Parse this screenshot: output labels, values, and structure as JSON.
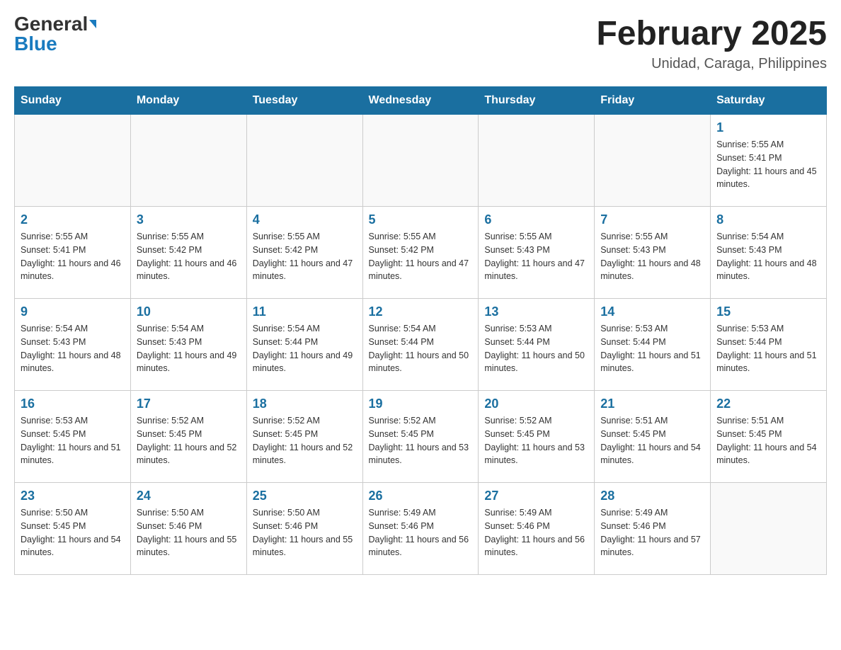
{
  "logo": {
    "general": "General",
    "blue": "Blue"
  },
  "title": {
    "month": "February 2025",
    "location": "Unidad, Caraga, Philippines"
  },
  "weekdays": [
    "Sunday",
    "Monday",
    "Tuesday",
    "Wednesday",
    "Thursday",
    "Friday",
    "Saturday"
  ],
  "weeks": [
    [
      {
        "day": "",
        "sunrise": "",
        "sunset": "",
        "daylight": ""
      },
      {
        "day": "",
        "sunrise": "",
        "sunset": "",
        "daylight": ""
      },
      {
        "day": "",
        "sunrise": "",
        "sunset": "",
        "daylight": ""
      },
      {
        "day": "",
        "sunrise": "",
        "sunset": "",
        "daylight": ""
      },
      {
        "day": "",
        "sunrise": "",
        "sunset": "",
        "daylight": ""
      },
      {
        "day": "",
        "sunrise": "",
        "sunset": "",
        "daylight": ""
      },
      {
        "day": "1",
        "sunrise": "Sunrise: 5:55 AM",
        "sunset": "Sunset: 5:41 PM",
        "daylight": "Daylight: 11 hours and 45 minutes."
      }
    ],
    [
      {
        "day": "2",
        "sunrise": "Sunrise: 5:55 AM",
        "sunset": "Sunset: 5:41 PM",
        "daylight": "Daylight: 11 hours and 46 minutes."
      },
      {
        "day": "3",
        "sunrise": "Sunrise: 5:55 AM",
        "sunset": "Sunset: 5:42 PM",
        "daylight": "Daylight: 11 hours and 46 minutes."
      },
      {
        "day": "4",
        "sunrise": "Sunrise: 5:55 AM",
        "sunset": "Sunset: 5:42 PM",
        "daylight": "Daylight: 11 hours and 47 minutes."
      },
      {
        "day": "5",
        "sunrise": "Sunrise: 5:55 AM",
        "sunset": "Sunset: 5:42 PM",
        "daylight": "Daylight: 11 hours and 47 minutes."
      },
      {
        "day": "6",
        "sunrise": "Sunrise: 5:55 AM",
        "sunset": "Sunset: 5:43 PM",
        "daylight": "Daylight: 11 hours and 47 minutes."
      },
      {
        "day": "7",
        "sunrise": "Sunrise: 5:55 AM",
        "sunset": "Sunset: 5:43 PM",
        "daylight": "Daylight: 11 hours and 48 minutes."
      },
      {
        "day": "8",
        "sunrise": "Sunrise: 5:54 AM",
        "sunset": "Sunset: 5:43 PM",
        "daylight": "Daylight: 11 hours and 48 minutes."
      }
    ],
    [
      {
        "day": "9",
        "sunrise": "Sunrise: 5:54 AM",
        "sunset": "Sunset: 5:43 PM",
        "daylight": "Daylight: 11 hours and 48 minutes."
      },
      {
        "day": "10",
        "sunrise": "Sunrise: 5:54 AM",
        "sunset": "Sunset: 5:43 PM",
        "daylight": "Daylight: 11 hours and 49 minutes."
      },
      {
        "day": "11",
        "sunrise": "Sunrise: 5:54 AM",
        "sunset": "Sunset: 5:44 PM",
        "daylight": "Daylight: 11 hours and 49 minutes."
      },
      {
        "day": "12",
        "sunrise": "Sunrise: 5:54 AM",
        "sunset": "Sunset: 5:44 PM",
        "daylight": "Daylight: 11 hours and 50 minutes."
      },
      {
        "day": "13",
        "sunrise": "Sunrise: 5:53 AM",
        "sunset": "Sunset: 5:44 PM",
        "daylight": "Daylight: 11 hours and 50 minutes."
      },
      {
        "day": "14",
        "sunrise": "Sunrise: 5:53 AM",
        "sunset": "Sunset: 5:44 PM",
        "daylight": "Daylight: 11 hours and 51 minutes."
      },
      {
        "day": "15",
        "sunrise": "Sunrise: 5:53 AM",
        "sunset": "Sunset: 5:44 PM",
        "daylight": "Daylight: 11 hours and 51 minutes."
      }
    ],
    [
      {
        "day": "16",
        "sunrise": "Sunrise: 5:53 AM",
        "sunset": "Sunset: 5:45 PM",
        "daylight": "Daylight: 11 hours and 51 minutes."
      },
      {
        "day": "17",
        "sunrise": "Sunrise: 5:52 AM",
        "sunset": "Sunset: 5:45 PM",
        "daylight": "Daylight: 11 hours and 52 minutes."
      },
      {
        "day": "18",
        "sunrise": "Sunrise: 5:52 AM",
        "sunset": "Sunset: 5:45 PM",
        "daylight": "Daylight: 11 hours and 52 minutes."
      },
      {
        "day": "19",
        "sunrise": "Sunrise: 5:52 AM",
        "sunset": "Sunset: 5:45 PM",
        "daylight": "Daylight: 11 hours and 53 minutes."
      },
      {
        "day": "20",
        "sunrise": "Sunrise: 5:52 AM",
        "sunset": "Sunset: 5:45 PM",
        "daylight": "Daylight: 11 hours and 53 minutes."
      },
      {
        "day": "21",
        "sunrise": "Sunrise: 5:51 AM",
        "sunset": "Sunset: 5:45 PM",
        "daylight": "Daylight: 11 hours and 54 minutes."
      },
      {
        "day": "22",
        "sunrise": "Sunrise: 5:51 AM",
        "sunset": "Sunset: 5:45 PM",
        "daylight": "Daylight: 11 hours and 54 minutes."
      }
    ],
    [
      {
        "day": "23",
        "sunrise": "Sunrise: 5:50 AM",
        "sunset": "Sunset: 5:45 PM",
        "daylight": "Daylight: 11 hours and 54 minutes."
      },
      {
        "day": "24",
        "sunrise": "Sunrise: 5:50 AM",
        "sunset": "Sunset: 5:46 PM",
        "daylight": "Daylight: 11 hours and 55 minutes."
      },
      {
        "day": "25",
        "sunrise": "Sunrise: 5:50 AM",
        "sunset": "Sunset: 5:46 PM",
        "daylight": "Daylight: 11 hours and 55 minutes."
      },
      {
        "day": "26",
        "sunrise": "Sunrise: 5:49 AM",
        "sunset": "Sunset: 5:46 PM",
        "daylight": "Daylight: 11 hours and 56 minutes."
      },
      {
        "day": "27",
        "sunrise": "Sunrise: 5:49 AM",
        "sunset": "Sunset: 5:46 PM",
        "daylight": "Daylight: 11 hours and 56 minutes."
      },
      {
        "day": "28",
        "sunrise": "Sunrise: 5:49 AM",
        "sunset": "Sunset: 5:46 PM",
        "daylight": "Daylight: 11 hours and 57 minutes."
      },
      {
        "day": "",
        "sunrise": "",
        "sunset": "",
        "daylight": ""
      }
    ]
  ]
}
